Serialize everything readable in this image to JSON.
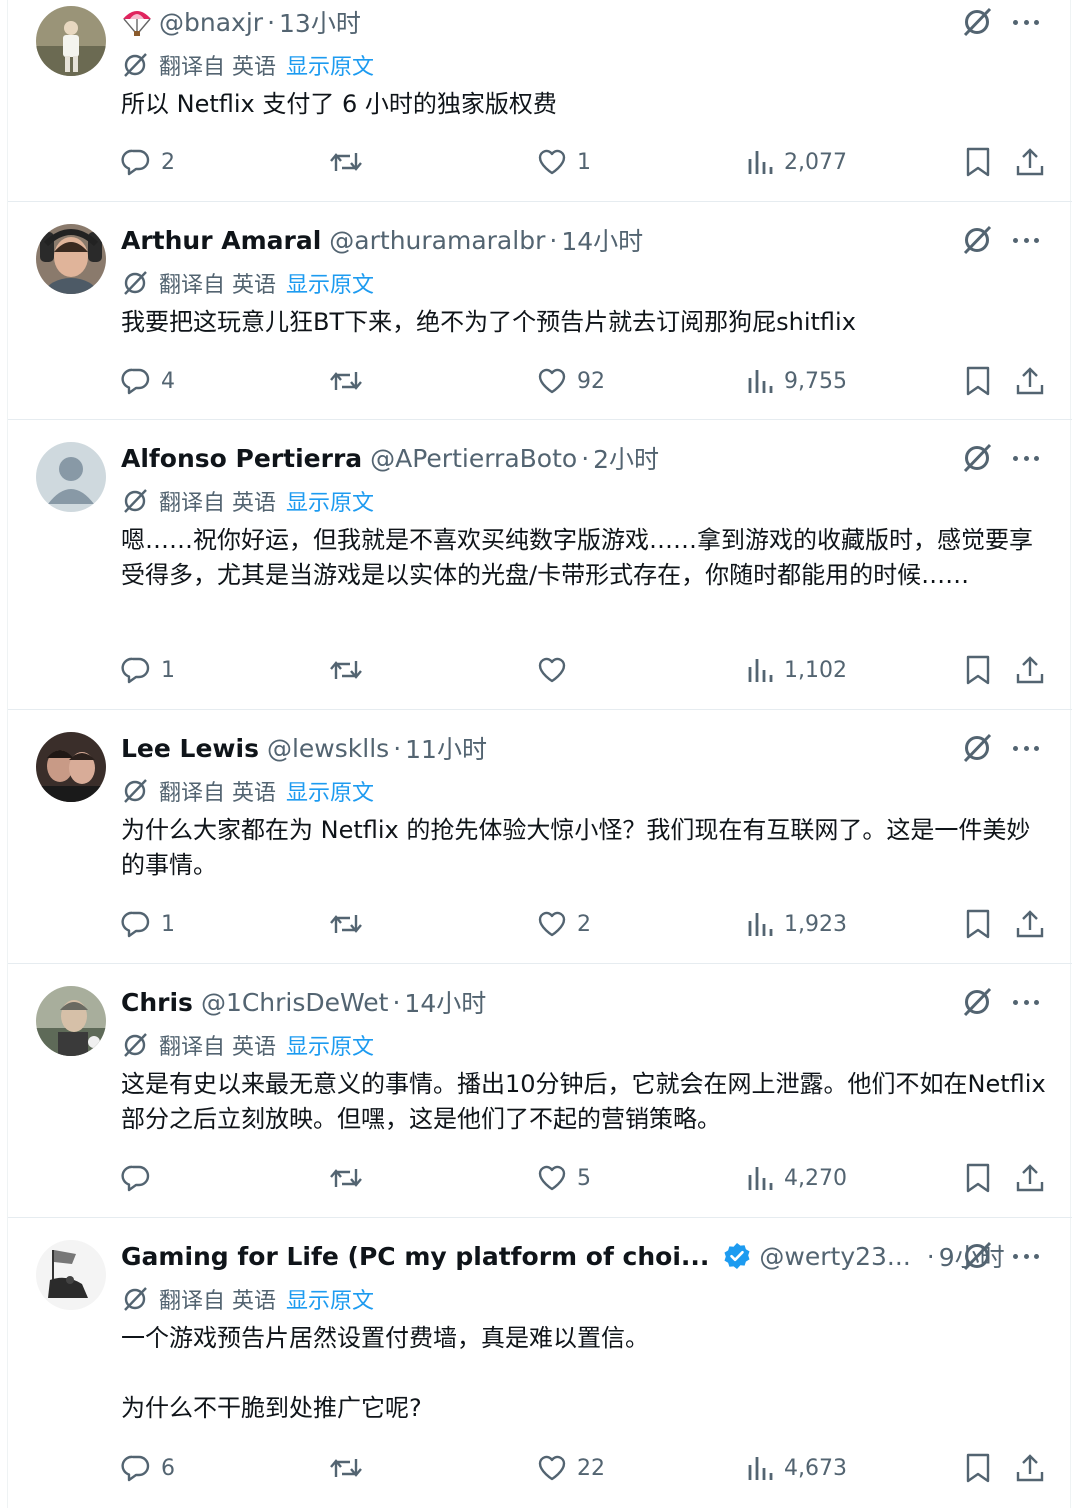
{
  "common": {
    "translated_from": "翻译自 英语",
    "show_original": "显示原文"
  },
  "posts": [
    {
      "name": "",
      "handle": "@bnaxjr",
      "time": "13小时",
      "text": "所以 Netflix 支付了 6 小时的独家版权费",
      "replies": "2",
      "reposts": "",
      "likes": "1",
      "views": "2,077"
    },
    {
      "name": "Arthur Amaral",
      "handle": "@arthuramaralbr",
      "time": "14小时",
      "text": "我要把这玩意儿狂BT下来，绝不为了个预告片就去订阅那狗屁shitflix",
      "replies": "4",
      "reposts": "",
      "likes": "92",
      "views": "9,755"
    },
    {
      "name": "Alfonso Pertierra",
      "handle": "@APertierraBoto",
      "time": "2小时",
      "text": "嗯……祝你好运，但我就是不喜欢买纯数字版游戏……拿到游戏的收藏版时，感觉要享受得多，尤其是当游戏是以实体的光盘/卡带形式存在，你随时都能用的时候……",
      "replies": "1",
      "reposts": "",
      "likes": "",
      "views": "1,102"
    },
    {
      "name": "Lee Lewis",
      "handle": "@lewsklls",
      "time": "11小时",
      "text": "为什么大家都在为 Netflix 的抢先体验大惊小怪？我们现在有互联网了。这是一件美妙的事情。",
      "replies": "1",
      "reposts": "",
      "likes": "2",
      "views": "1,923"
    },
    {
      "name": "Chris",
      "handle": "@1ChrisDeWet",
      "time": "14小时",
      "text": "这是有史以来最无意义的事情。播出10分钟后，它就会在网上泄露。他们不如在Netflix部分之后立刻放映。但嘿，这是他们了不起的营销策略。",
      "replies": "",
      "reposts": "",
      "likes": "5",
      "views": "4,270"
    },
    {
      "name": "Gaming for Life (PC my platform of choi...",
      "handle": "@werty23...",
      "time": "9小时",
      "text": "一个游戏预告片居然设置付费墙，真是难以置信。\n\n为什么不干脆到处推广它呢?",
      "replies": "6",
      "reposts": "",
      "likes": "22",
      "views": "4,673"
    }
  ]
}
